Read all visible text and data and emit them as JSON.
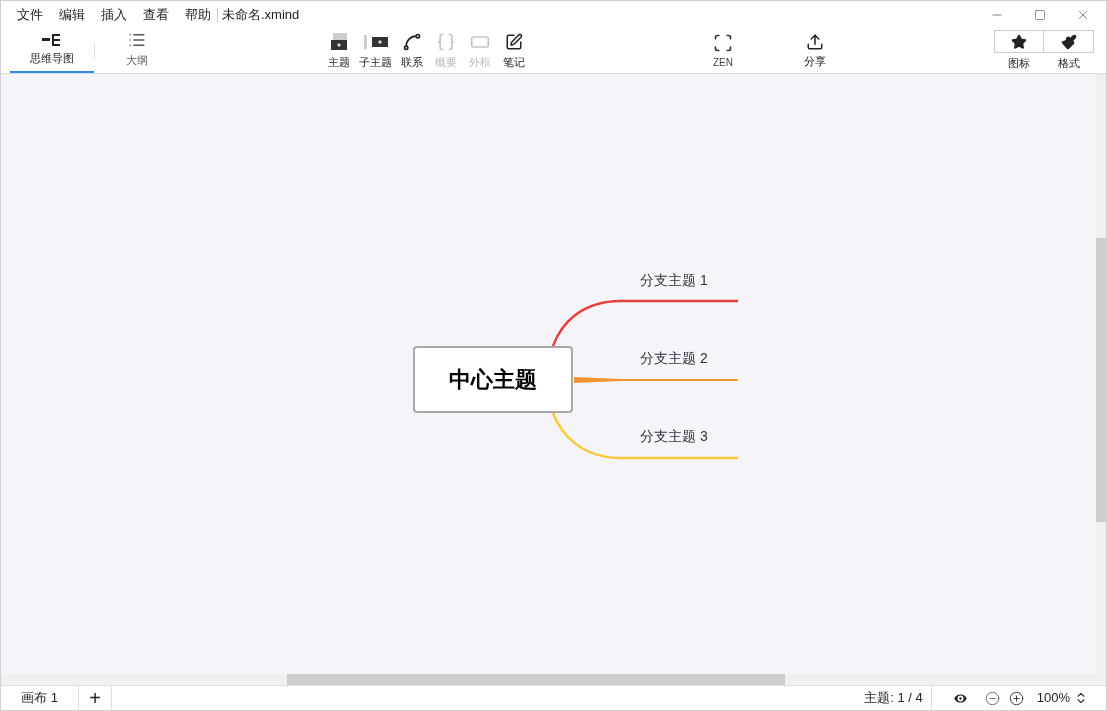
{
  "menu": [
    "文件",
    "编辑",
    "插入",
    "查看",
    "帮助"
  ],
  "document_title": "未命名.xmind",
  "views": [
    {
      "label": "思维导图",
      "kind": "mindmap",
      "selected": true
    },
    {
      "label": "大纲",
      "kind": "outline",
      "selected": false
    }
  ],
  "tools": [
    {
      "label": "主题",
      "kind": "topic",
      "disabled": false
    },
    {
      "label": "子主题",
      "kind": "subtopic",
      "disabled": false
    },
    {
      "label": "联系",
      "kind": "relationship",
      "disabled": false
    },
    {
      "label": "概要",
      "kind": "summary",
      "disabled": true
    },
    {
      "label": "外框",
      "kind": "boundary",
      "disabled": true
    },
    {
      "label": "笔记",
      "kind": "note",
      "disabled": false
    }
  ],
  "zen": {
    "label": "ZEN"
  },
  "share": {
    "label": "分享"
  },
  "panels": [
    {
      "label": "图标",
      "kind": "icons"
    },
    {
      "label": "格式",
      "kind": "format"
    }
  ],
  "mindmap": {
    "central": "中心主题",
    "branches": [
      {
        "label": "分支主题 1",
        "color": "#e8403a"
      },
      {
        "label": "分支主题 2",
        "color": "#f39230"
      },
      {
        "label": "分支主题 3",
        "color": "#fbc93a"
      }
    ]
  },
  "status_bar": {
    "sheet": "画布 1",
    "add": "+",
    "topic_count": "主题: 1 / 4",
    "zoom": "100%"
  }
}
